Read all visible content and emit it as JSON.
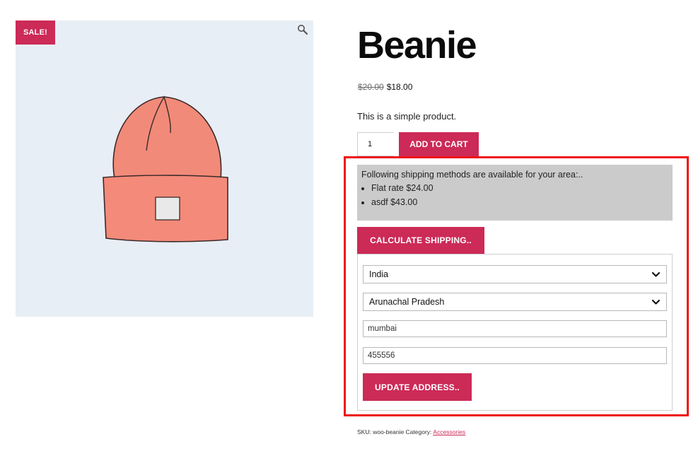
{
  "sale_badge": "SALE!",
  "product": {
    "title": "Beanie",
    "old_price": "$20.00",
    "price": "$18.00",
    "description": "This is a simple product.",
    "quantity": "1",
    "add_to_cart_label": "ADD TO CART"
  },
  "shipping": {
    "intro": "Following shipping methods are available for your area:..",
    "methods": [
      "Flat rate $24.00",
      "asdf $43.00"
    ],
    "calculate_label": "CALCULATE SHIPPING..",
    "country": "India",
    "state": "Arunachal Pradesh",
    "city": "mumbai",
    "postcode": "455556",
    "update_label": "UPDATE ADDRESS.."
  },
  "meta": {
    "sku_label": "SKU:",
    "sku": "woo-beanie",
    "category_label": "Category:",
    "category": "Accessories"
  },
  "icons": {
    "zoom": "magnifier-icon",
    "chevron": "chevron-down-icon"
  },
  "colors": {
    "accent": "#cc2a57",
    "highlight": "#ee1111",
    "image_bg": "#e8eef5",
    "methods_bg": "#cbcbcb"
  }
}
